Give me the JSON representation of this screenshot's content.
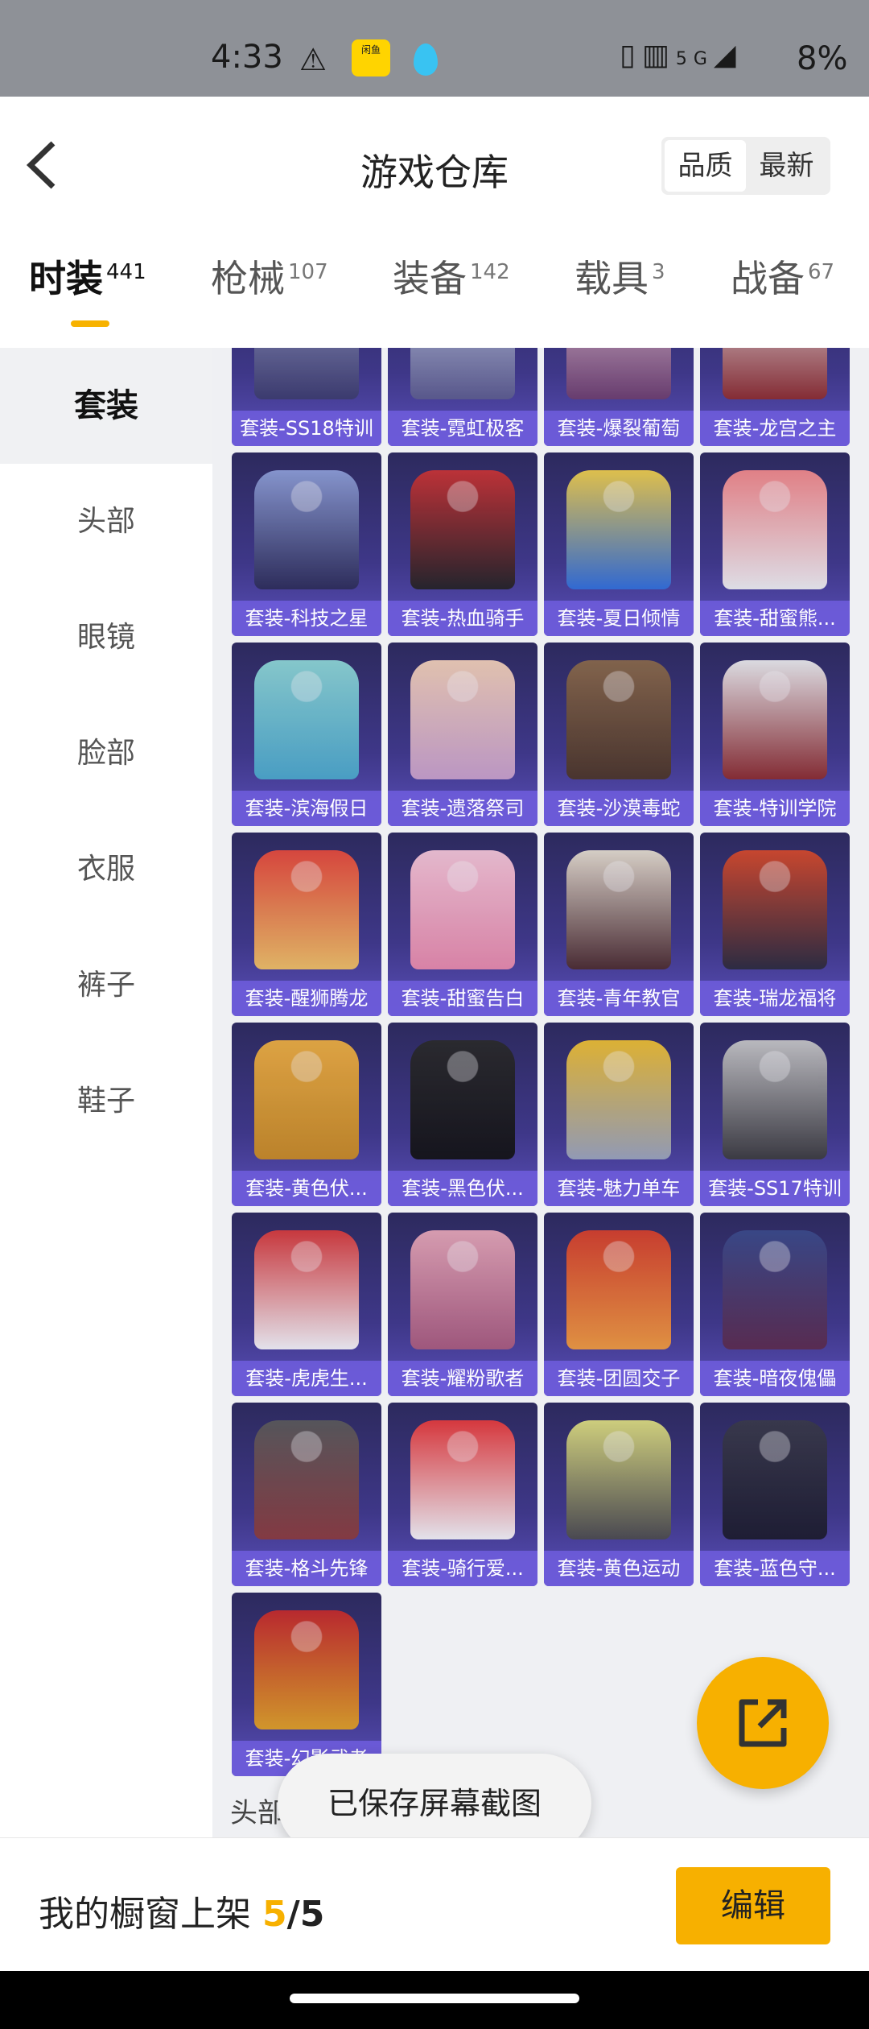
{
  "status_bar": {
    "time": "4:33",
    "app_badge": "闲鱼",
    "battery": "8%",
    "network": "5G"
  },
  "header": {
    "title": "游戏仓库",
    "sort_options": [
      "品质",
      "最新"
    ],
    "sort_selected": "品质"
  },
  "tabs": [
    {
      "label": "时装",
      "count": "441",
      "active": true
    },
    {
      "label": "枪械",
      "count": "107",
      "active": false
    },
    {
      "label": "装备",
      "count": "142",
      "active": false
    },
    {
      "label": "载具",
      "count": "3",
      "active": false
    },
    {
      "label": "战备",
      "count": "67",
      "active": false
    }
  ],
  "sidebar": {
    "items": [
      "套装",
      "头部",
      "眼镜",
      "脸部",
      "衣服",
      "裤子",
      "鞋子"
    ],
    "active": "套装"
  },
  "items": [
    "套装-SS18特训",
    "套装-霓虹极客",
    "套装-爆裂葡萄",
    "套装-龙宫之主",
    "套装-科技之星",
    "套装-热血骑手",
    "套装-夏日倾情",
    "套装-甜蜜熊...",
    "套装-滨海假日",
    "套装-遗落祭司",
    "套装-沙漠毒蛇",
    "套装-特训学院",
    "套装-醒狮腾龙",
    "套装-甜蜜告白",
    "套装-青年教官",
    "套装-瑞龙福将",
    "套装-黄色伏...",
    "套装-黑色伏...",
    "套装-魅力单车",
    "套装-SS17特训",
    "套装-虎虎生...",
    "套装-耀粉歌者",
    "套装-团圆交子",
    "套装-暗夜傀儡",
    "套装-格斗先锋",
    "套装-骑行爱...",
    "套装-黄色运动",
    "套装-蓝色守...",
    "套装-幻影武者"
  ],
  "next_section": "头部",
  "toast": "已保存屏幕截图",
  "bottom": {
    "shelf_label": "我的橱窗上架",
    "shelf_current": "5",
    "shelf_separator": "/",
    "shelf_total": "5",
    "edit_label": "编辑"
  },
  "colors": {
    "accent": "#f7b000",
    "card_label_bg": "#6e5cdc"
  },
  "icons": {
    "back": "chevron-left-icon",
    "fab": "external-link-icon"
  }
}
